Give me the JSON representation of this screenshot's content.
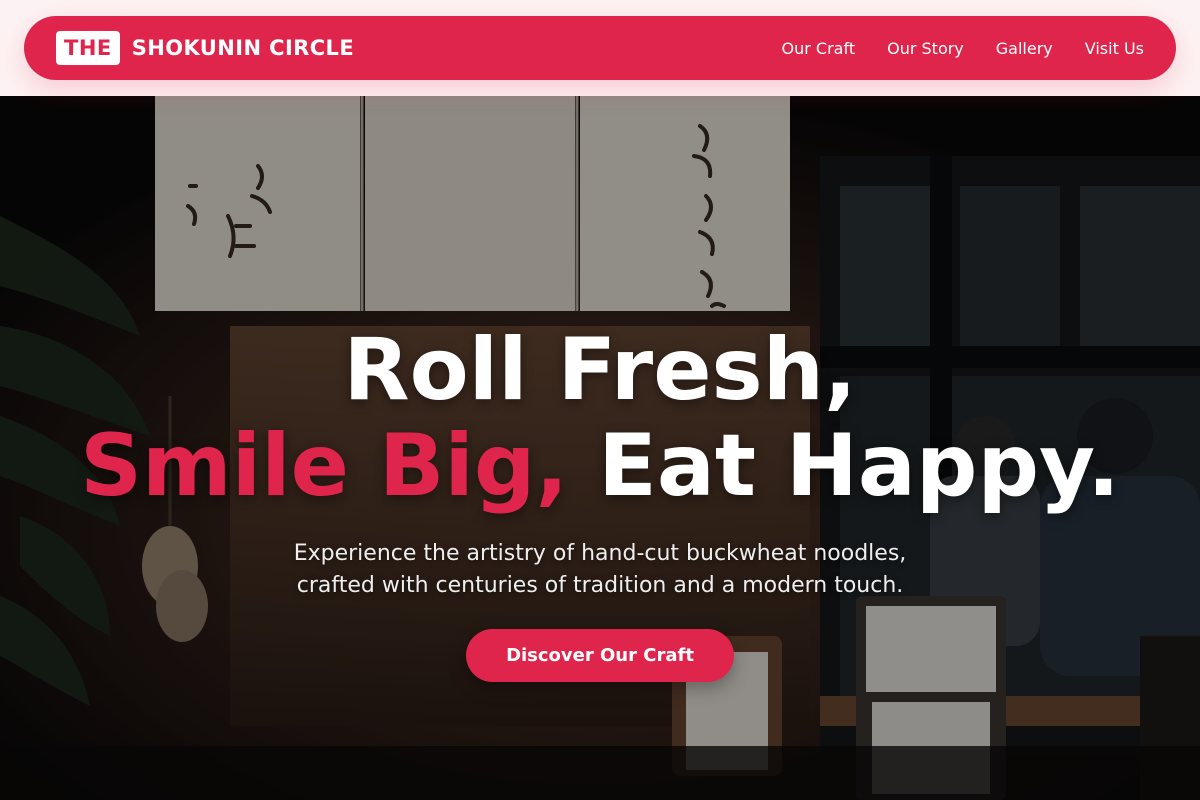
{
  "header": {
    "brand_badge": "THE",
    "brand_name": "SHOKUNIN CIRCLE",
    "nav": [
      {
        "label": "Our Craft"
      },
      {
        "label": "Our Story"
      },
      {
        "label": "Gallery"
      },
      {
        "label": "Visit Us"
      }
    ]
  },
  "hero": {
    "headline_line1": "Roll Fresh,",
    "headline_accent": "Smile Big,",
    "headline_rest": "Eat Happy.",
    "subtitle_line1": "Experience the artistry of hand-cut buckwheat noodles,",
    "subtitle_line2": "crafted with centuries of tradition and a modern touch.",
    "cta_label": "Discover Our Craft",
    "background_icon": "restaurant-storefront-photo"
  },
  "colors": {
    "accent": "#df254b",
    "header_bg": "#df254b",
    "page_bg": "#fdf2f3",
    "text_light": "#ffffff"
  }
}
